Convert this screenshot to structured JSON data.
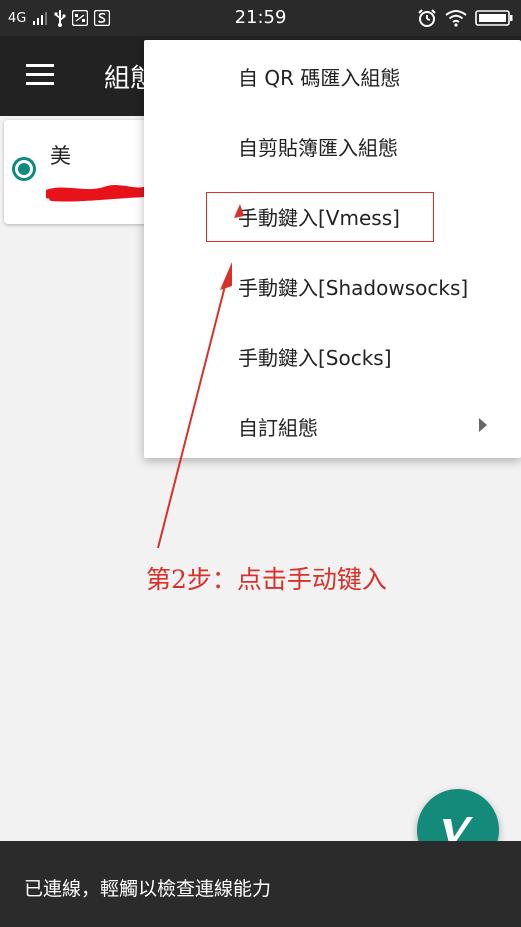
{
  "status_bar": {
    "network": "4G",
    "time": "21:59"
  },
  "toolbar": {
    "title": "組態"
  },
  "server_card": {
    "name": "美",
    "selected": true
  },
  "popup_menu": {
    "items": [
      {
        "label": "自 QR 碼匯入組態"
      },
      {
        "label": "自剪貼簿匯入組態"
      },
      {
        "label": "手動鍵入[Vmess]"
      },
      {
        "label": "手動鍵入[Shadowsocks]"
      },
      {
        "label": "手動鍵入[Socks]"
      },
      {
        "label": "自訂組態"
      }
    ]
  },
  "annotation": {
    "text": "第2步：点击手动键入",
    "color": "#d9302a"
  },
  "bottom_bar": {
    "text": "已連線，輕觸以檢查連線能力"
  },
  "colors": {
    "accent": "#138a7a",
    "toolbar": "#222222",
    "annotation": "#d9302a"
  }
}
